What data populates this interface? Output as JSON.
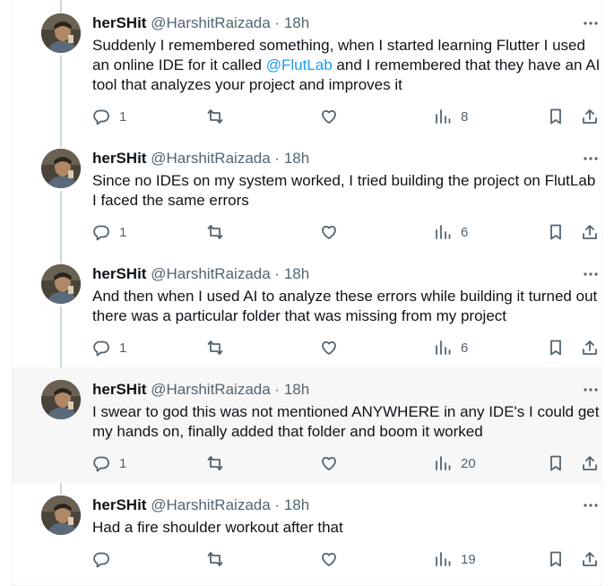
{
  "tweets": [
    {
      "name": "herSHit",
      "handle": "@HarshitRaizada",
      "dot": "·",
      "time": "18h",
      "text_before": "Suddenly I remembered something, when I started learning Flutter I used an online IDE for it called ",
      "mention": "@FlutLab",
      "text_after": " and I remembered that they have an AI tool that analyzes your project and improves it",
      "replies": "1",
      "reposts": "",
      "likes": "",
      "views": "8"
    },
    {
      "name": "herSHit",
      "handle": "@HarshitRaizada",
      "dot": "·",
      "time": "18h",
      "text": "Since no IDEs on my system worked, I tried building the project on FlutLab I faced the same errors",
      "replies": "1",
      "reposts": "",
      "likes": "",
      "views": "6"
    },
    {
      "name": "herSHit",
      "handle": "@HarshitRaizada",
      "dot": "·",
      "time": "18h",
      "text": "And then when I used AI to analyze these errors while building it turned out there was a particular folder that was missing from my project",
      "replies": "1",
      "reposts": "",
      "likes": "",
      "views": "6"
    },
    {
      "name": "herSHit",
      "handle": "@HarshitRaizada",
      "dot": "·",
      "time": "18h",
      "text": "I swear to god this was not mentioned ANYWHERE in any IDE's I could get my hands on, finally added that folder and boom it worked",
      "replies": "1",
      "reposts": "",
      "likes": "",
      "views": "20"
    },
    {
      "name": "herSHit",
      "handle": "@HarshitRaizada",
      "dot": "·",
      "time": "18h",
      "text": "Had a fire shoulder workout after that",
      "replies": "",
      "reposts": "",
      "likes": "",
      "views": "19"
    }
  ],
  "colors": {
    "text": "#0f1419",
    "secondary": "#536471",
    "link": "#1d9bf0",
    "thread_line": "#cfd9de",
    "hover_bg": "#f7f7f7"
  },
  "icons": [
    "reply-icon",
    "repost-icon",
    "like-icon",
    "views-icon",
    "bookmark-icon",
    "share-icon",
    "more-icon"
  ]
}
